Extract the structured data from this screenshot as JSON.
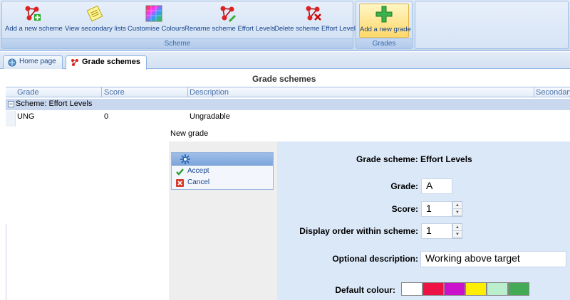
{
  "ribbon": {
    "groups": [
      {
        "label": "Scheme"
      },
      {
        "label": "Grades"
      }
    ],
    "buttons": [
      {
        "label": "Add a new scheme",
        "icon": "molecule-add-icon"
      },
      {
        "label": "View secondary lists",
        "icon": "notepad-icon"
      },
      {
        "label": "Customise Colours",
        "icon": "color-palette-icon"
      },
      {
        "label": "Rename scheme Effort Levels",
        "icon": "molecule-edit-icon"
      },
      {
        "label": "Delete scheme Effort Levels",
        "icon": "molecule-delete-icon"
      },
      {
        "label": "Add a new grade",
        "icon": "green-plus-icon"
      }
    ]
  },
  "tabs": [
    {
      "label": "Home page",
      "icon": "home-globe-icon"
    },
    {
      "label": "Grade schemes",
      "icon": "molecule-icon"
    }
  ],
  "grid": {
    "title": "Grade schemes",
    "columns": [
      "Grade",
      "Score",
      "Description",
      "Secondary"
    ],
    "group_label": "Scheme: Effort Levels",
    "rows": [
      {
        "grade": "UNG",
        "score": "0",
        "description": "Ungradable"
      }
    ]
  },
  "dialog": {
    "title": "New grade",
    "actions": [
      {
        "label": "Accept",
        "icon": "check-icon"
      },
      {
        "label": "Cancel",
        "icon": "cancel-x-icon"
      }
    ],
    "heading": "Grade scheme: Effort Levels",
    "fields": {
      "grade": {
        "label": "Grade:",
        "value": "A"
      },
      "score": {
        "label": "Score:",
        "value": "1"
      },
      "display_order": {
        "label": "Display order within scheme:",
        "value": "1"
      },
      "description": {
        "label": "Optional description:",
        "value": "Working above target"
      },
      "colour": {
        "label": "Default colour:"
      }
    },
    "colours": [
      "#ffffff",
      "#ee1144",
      "#cc11cc",
      "#ffee00",
      "#bbeecc",
      "#44aa55"
    ]
  },
  "colors": {
    "ribbon_text": "#15428b",
    "dialog_panel": "#dbe8f8",
    "group_row": "#c9d8ee"
  }
}
